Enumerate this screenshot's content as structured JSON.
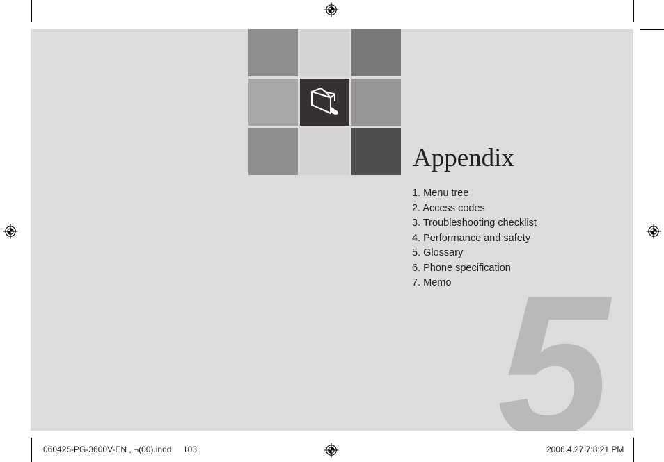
{
  "document": {
    "chapter_numeral": "5",
    "chapter_title": "Appendix"
  },
  "toc": {
    "items": [
      "1. Menu tree",
      "2. Access codes",
      "3. Troubleshooting checklist",
      "4. Performance and safety",
      "5. Glossary",
      "6. Phone specification",
      "7. Memo"
    ]
  },
  "icon_grid": {
    "center_icon": "folder-icon",
    "cells": [
      {
        "name": "grid-cell-1",
        "color": "#8e8e8e"
      },
      {
        "name": "grid-cell-2",
        "color": "#d3d3d3"
      },
      {
        "name": "grid-cell-3",
        "color": "#787878"
      },
      {
        "name": "grid-cell-4",
        "color": "#a8a8a8"
      },
      {
        "name": "grid-cell-5",
        "color": "#353132"
      },
      {
        "name": "grid-cell-6",
        "color": "#959595"
      },
      {
        "name": "grid-cell-7",
        "color": "#8e8e8e"
      },
      {
        "name": "grid-cell-8",
        "color": "#d3d3d3"
      },
      {
        "name": "grid-cell-9",
        "color": "#4e4e4e"
      }
    ]
  },
  "footer": {
    "filename": "060425-PG-3600V-EN , ¬(00).indd",
    "page_number": "103",
    "timestamp": "2006.4.27   7:8:21 PM"
  },
  "colors": {
    "page_background": "#dcdcdc",
    "sheet_background": "#ffffff",
    "text": "#231f20",
    "watermark": "#b9b9b9",
    "crop_mark": "#000000"
  },
  "print_marks": {
    "registration_targets": [
      "top-center",
      "left-middle",
      "right-middle",
      "bottom-center"
    ],
    "crop_mark_label": "crop-mark"
  }
}
